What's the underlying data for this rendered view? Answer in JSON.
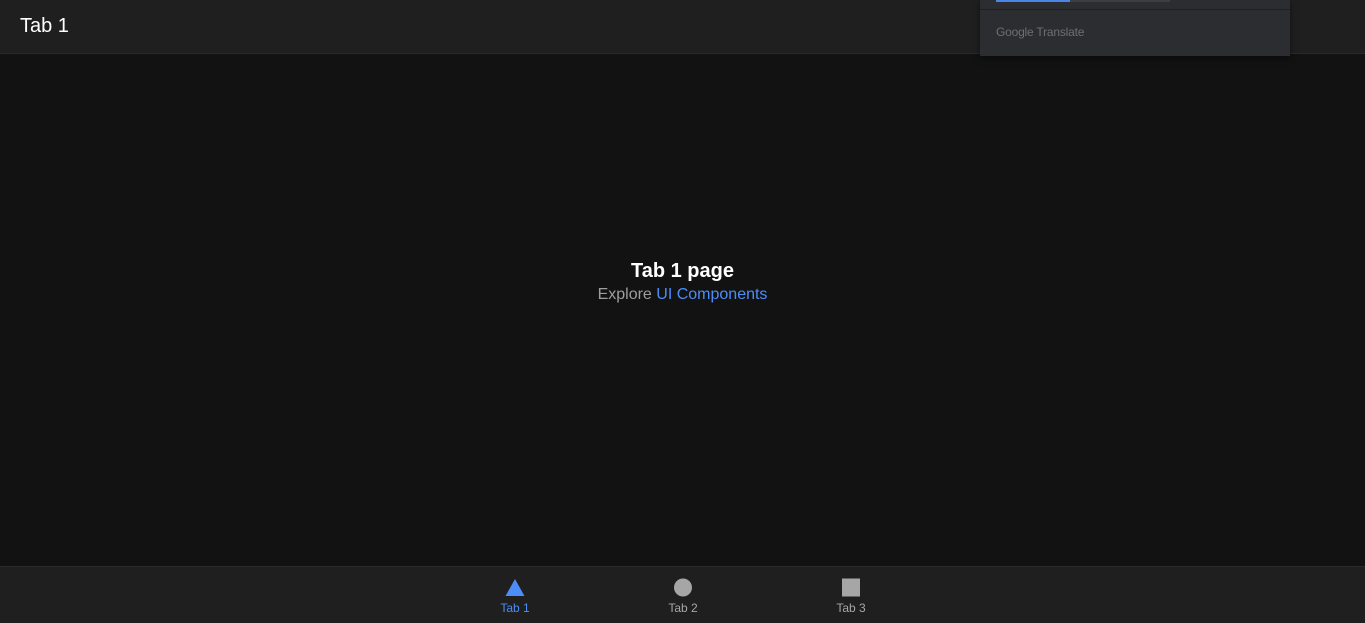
{
  "header": {
    "title": "Tab 1"
  },
  "translate_popup": {
    "brand": "Google",
    "label": "Translate"
  },
  "main": {
    "title": "Tab 1 page",
    "subtitle_prefix": "Explore",
    "link_label": "UI Components"
  },
  "tabbar": {
    "active_color": "#4d8df7",
    "inactive_color": "#a6a6a6",
    "tabs": [
      {
        "label": "Tab 1",
        "icon": "triangle-icon",
        "active": true
      },
      {
        "label": "Tab 2",
        "icon": "circle-icon",
        "active": false
      },
      {
        "label": "Tab 3",
        "icon": "square-icon",
        "active": false
      }
    ]
  }
}
